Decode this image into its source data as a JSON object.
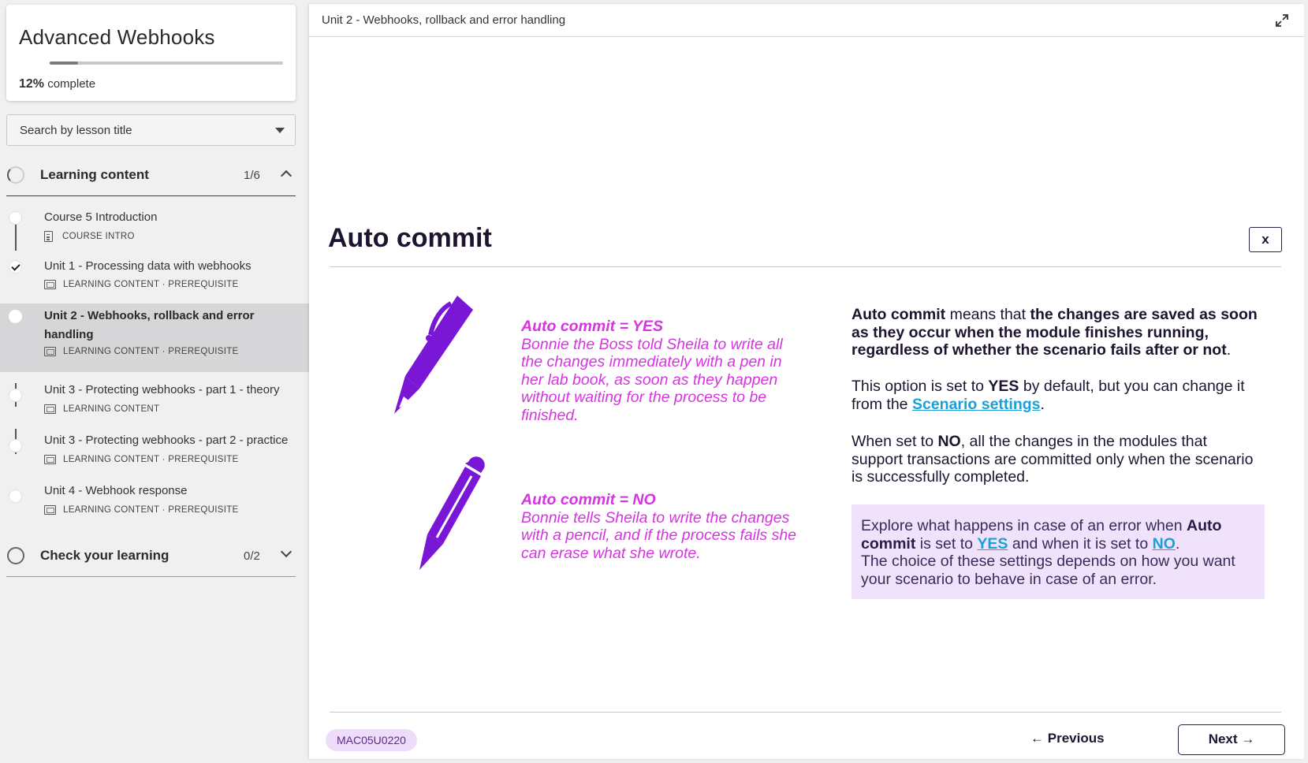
{
  "course": {
    "title": "Advanced Webhooks",
    "progress_percent_label": "12%",
    "progress_suffix": "complete",
    "progress_fraction": 0.12
  },
  "search": {
    "placeholder": "Search by lesson title"
  },
  "sections": [
    {
      "label": "Learning content",
      "count": "1/6",
      "state": "expanded"
    },
    {
      "label": "Check your learning",
      "count": "0/2",
      "state": "collapsed"
    }
  ],
  "lessons": [
    {
      "title": "Course 5 Introduction",
      "meta": "COURSE INTRO",
      "status": "incomplete",
      "icon": "document-icon"
    },
    {
      "title": "Unit 1 - Processing data with webhooks",
      "meta": "LEARNING CONTENT · PREREQUISITE",
      "status": "complete",
      "icon": "slides-icon"
    },
    {
      "title": "Unit 2 - Webhooks, rollback and error handling",
      "meta": "LEARNING CONTENT · PREREQUISITE",
      "status": "current",
      "icon": "slides-icon"
    },
    {
      "title": "Unit 3 - Protecting webhooks - part 1 - theory",
      "meta": "LEARNING CONTENT",
      "status": "incomplete",
      "icon": "slides-icon"
    },
    {
      "title": "Unit 3 - Protecting webhooks - part 2 - practice",
      "meta": "LEARNING CONTENT · PREREQUISITE",
      "status": "incomplete",
      "icon": "slides-icon"
    },
    {
      "title": "Unit 4 - Webhook response",
      "meta": "LEARNING CONTENT · PREREQUISITE",
      "status": "incomplete",
      "icon": "slides-icon"
    }
  ],
  "topbar": {
    "breadcrumb": "Unit 2 - Webhooks, rollback and error handling",
    "expand_icon": "expand-icon"
  },
  "slide": {
    "title": "Auto commit",
    "close_label": "x",
    "yes_caption_title": "Auto commit = YES",
    "yes_caption_body": "Bonnie the Boss told Sheila to write all the changes immediately with a pen in her lab book, as soon as they happen without waiting for the process to be finished.",
    "no_caption_title": "Auto commit = NO",
    "no_caption_body": "Bonnie tells Sheila to write the changes with a pencil, and if the process fails she can erase what she wrote.",
    "p1_a": "Auto commit",
    "p1_b": " means that ",
    "p1_c": "the changes are saved as soon as they occur when the module finishes running, regardless of whether the scenario fails after or not",
    "p1_d": ".",
    "p2_a": "This option is set to ",
    "p2_b": "YES",
    "p2_c": " by default, but you can change it from the ",
    "p2_link": "Scenario settings",
    "p2_d": ".",
    "p3_a": "When set to ",
    "p3_b": "NO",
    "p3_c": ", all the changes in the modules that support transactions are committed only when the scenario is successfully completed.",
    "callout_a": "Explore what happens in case of an error when ",
    "callout_b": "Auto commit",
    "callout_c": " is set to ",
    "callout_link_yes": "YES",
    "callout_d": " and when it is set to ",
    "callout_link_no": "NO",
    "callout_e": ".",
    "callout_f": "The choice of these settings depends on how you want your scenario to behave in case of an error."
  },
  "footer": {
    "code": "MAC05U0220",
    "previous_label": "Previous",
    "next_label": "Next"
  },
  "colors": {
    "accent_purple": "#7a16d6",
    "caption_magenta": "#d534e0",
    "link_blue": "#1aa0d8",
    "callout_bg": "#f1e2fb",
    "title_dark": "#1e1430"
  }
}
